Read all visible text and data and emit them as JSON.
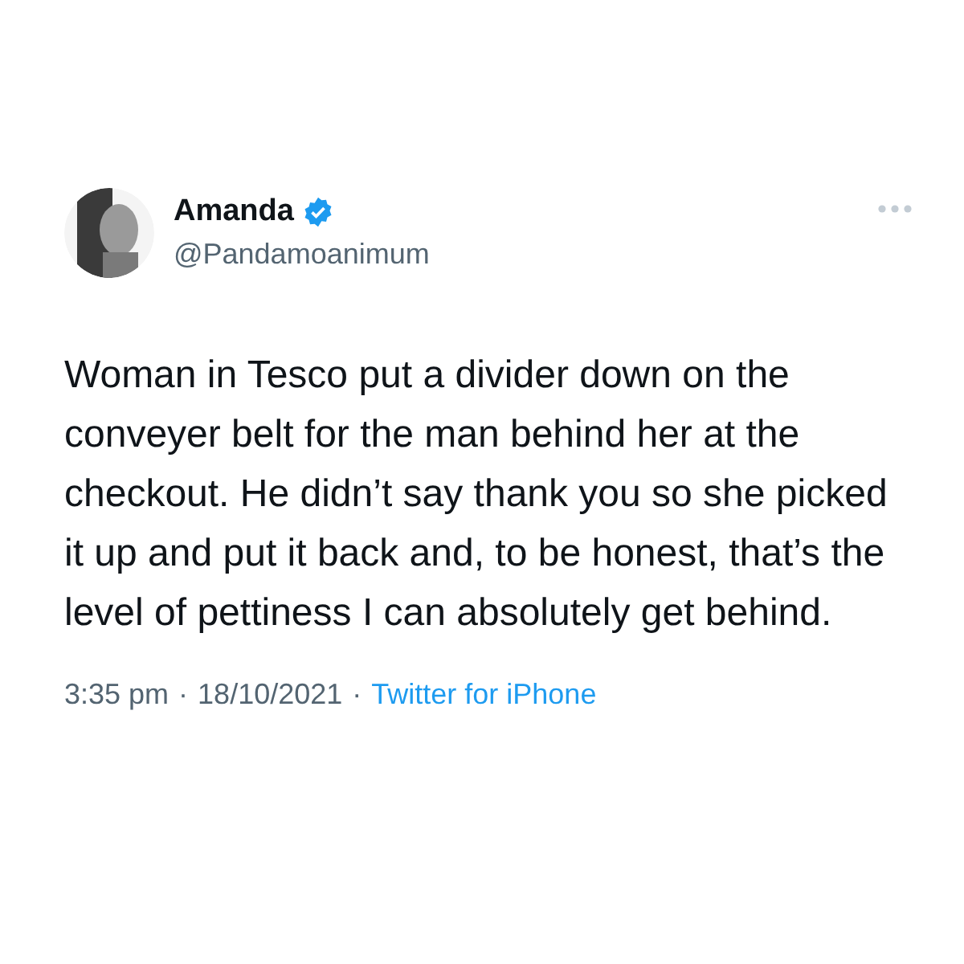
{
  "author": {
    "name": "Amanda",
    "verified": true,
    "handle": "@Pandamoanimum"
  },
  "body": "Woman in Tesco put a divider down on the conveyer belt for the man behind her at the checkout. He didn’t say thank you so she picked it up and put it back and, to be honest, that’s the level of pettiness I can absolutely get behind.",
  "footer": {
    "time": "3:35 pm",
    "separators": [
      "·",
      "·"
    ],
    "date": "18/10/2021",
    "source": "Twitter for iPhone"
  }
}
